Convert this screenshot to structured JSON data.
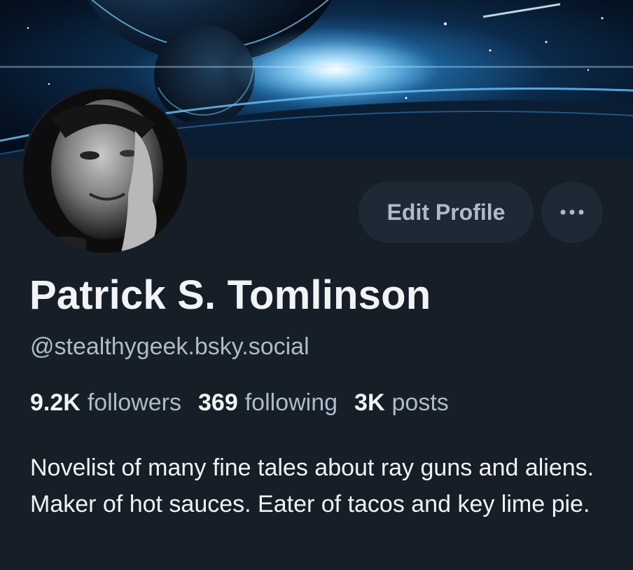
{
  "profile": {
    "display_name": "Patrick S. Tomlinson",
    "handle": "@stealthygeek.bsky.social",
    "bio": "Novelist of many fine tales about ray guns and aliens. Maker of hot sauces. Eater of tacos and key lime pie."
  },
  "stats": {
    "followers_count": "9.2K",
    "followers_label": "followers",
    "following_count": "369",
    "following_label": "following",
    "posts_count": "3K",
    "posts_label": "posts"
  },
  "actions": {
    "edit_profile_label": "Edit Profile",
    "more_icon": "ellipsis-icon"
  },
  "colors": {
    "background": "#161e27",
    "button_background": "#1e2936",
    "text_primary": "#f1f3f5",
    "text_secondary": "#aebbc9"
  }
}
